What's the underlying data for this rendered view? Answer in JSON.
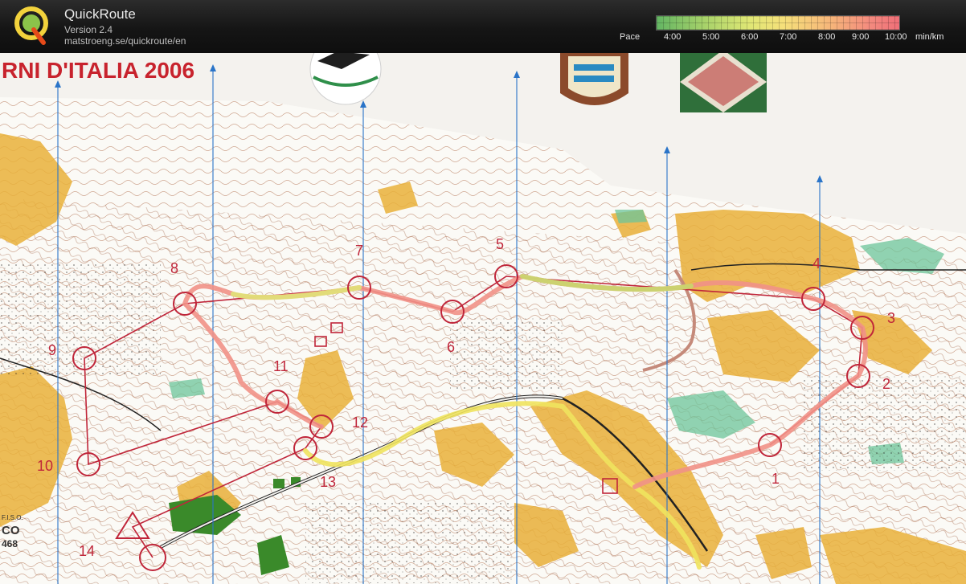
{
  "header": {
    "logo_letter": "Q",
    "app_name": "QuickRoute",
    "version": "Version 2.4",
    "url": "matstroeng.se/quickroute/en",
    "pace_label": "Pace",
    "pace_ticks": [
      "4:00",
      "5:00",
      "6:00",
      "7:00",
      "8:00",
      "9:00",
      "10:00"
    ],
    "pace_unit": "min/km"
  },
  "map": {
    "event_title": "RNI D'ITALIA 2006",
    "fiso": {
      "label": "F.I.S.O.",
      "co": "CO",
      "number": "468"
    },
    "controls": [
      {
        "label": "1"
      },
      {
        "label": "2"
      },
      {
        "label": "3"
      },
      {
        "label": "4"
      },
      {
        "label": "5"
      },
      {
        "label": "6"
      },
      {
        "label": "7"
      },
      {
        "label": "8"
      },
      {
        "label": "9"
      },
      {
        "label": "10"
      },
      {
        "label": "11"
      },
      {
        "label": "12"
      },
      {
        "label": "13"
      },
      {
        "label": "14"
      }
    ]
  },
  "colors": {
    "header_bg": "#151515",
    "course_red": "#c0263a",
    "map_paper": "#f4f2ee",
    "open_land": "#e9b03a",
    "meadow_green": "#6cc49a",
    "settlement_green": "#3a8a2a"
  },
  "icons": {
    "logo": "quickroute-logo-icon",
    "north_lines": "north-arrow-icon"
  }
}
